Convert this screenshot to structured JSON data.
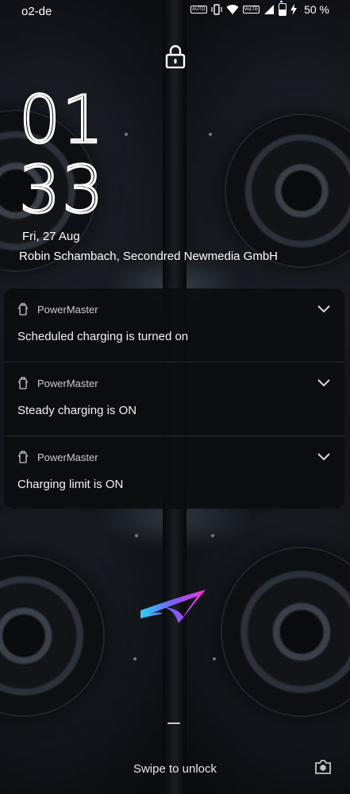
{
  "status_bar": {
    "carrier": "o2-de",
    "nfc_label": "AUTO",
    "volte_label": "VoLTE",
    "battery_percent": "50 %"
  },
  "lockscreen": {
    "clock_hours": "01",
    "clock_minutes": "33",
    "date": "Fri, 27 Aug",
    "owner_info": "Robin Schambach, Secondred Newmedia GmbH"
  },
  "notifications": [
    {
      "app": "PowerMaster",
      "title": "Scheduled charging is turned on"
    },
    {
      "app": "PowerMaster",
      "title": "Steady charging is ON"
    },
    {
      "app": "PowerMaster",
      "title": "Charging limit is ON"
    }
  ],
  "bottom": {
    "swipe_hint": "Swipe to unlock"
  },
  "colors": {
    "background": "#0b0d10",
    "notification_panel": "#0c0d0f",
    "text": "#ffffff",
    "logo_gradient": [
      "#27d3f5",
      "#7b5cff",
      "#ff2fd0"
    ]
  },
  "icons": [
    "lock-icon",
    "vibrate-icon",
    "wifi-icon",
    "signal-icon",
    "battery-icon",
    "charging-icon",
    "powermaster-icon",
    "chevron-down-icon",
    "rog-logo",
    "camera-icon"
  ]
}
